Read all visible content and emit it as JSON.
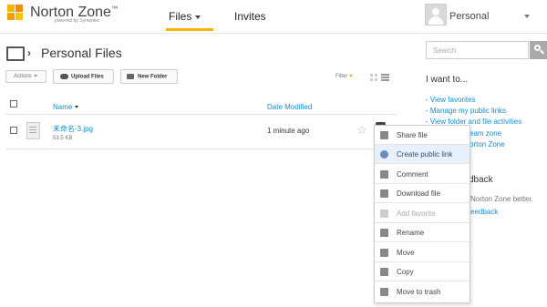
{
  "header": {
    "brand": "Norton Zone",
    "brand_tm": "™",
    "brand_sub": "powered by Symantec",
    "nav": [
      {
        "label": "Files"
      },
      {
        "label": "Invites"
      }
    ],
    "user_name": "Personal"
  },
  "breadcrumb": {
    "title": "Personal Files"
  },
  "toolbar": {
    "actions_label": "Actions",
    "upload_label": "Upload Files",
    "new_folder_label": "New Folder",
    "filter_label": "Filter"
  },
  "table": {
    "columns": [
      "Name",
      "Date Modified"
    ],
    "rows": [
      {
        "name": "未命名-3.jpg",
        "size": "53.5 KB",
        "modified": "1 minute ago"
      }
    ]
  },
  "context_menu": {
    "items": [
      {
        "label": "Share file",
        "icon": "share-icon"
      },
      {
        "label": "Create public link",
        "icon": "link-icon"
      },
      {
        "label": "Comment",
        "icon": "comment-icon"
      },
      {
        "label": "Download file",
        "icon": "download-icon"
      },
      {
        "label": "Add favorite",
        "icon": "star-icon"
      },
      {
        "label": "Rename",
        "icon": "pencil-icon"
      },
      {
        "label": "Move",
        "icon": "move-icon"
      },
      {
        "label": "Copy",
        "icon": "copy-icon"
      },
      {
        "label": "Move to trash",
        "icon": "trash-icon"
      }
    ]
  },
  "sidebar": {
    "search_placeholder": "Search",
    "want_title": "I want to...",
    "links": [
      "- View favorites",
      "- Manage my public links",
      "- View folder and file activities"
    ],
    "partial_link_1": "eam zone",
    "partial_link_2": "orton Zone",
    "feedback_title": "dback",
    "feedback_text": "Norton Zone better.",
    "feedback_link": "eedback"
  },
  "colors": {
    "accent": "#f7b500",
    "link": "#1a8bc8"
  }
}
